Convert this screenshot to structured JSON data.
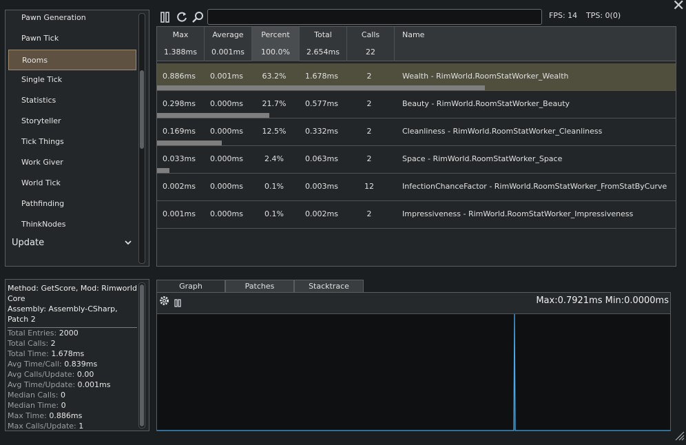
{
  "sidebar": {
    "items": [
      {
        "label": "Pawn Generation"
      },
      {
        "label": "Pawn Tick"
      },
      {
        "label": "Rooms",
        "selected": true
      },
      {
        "label": "Single Tick"
      },
      {
        "label": "Statistics"
      },
      {
        "label": "Storyteller"
      },
      {
        "label": "Tick Things"
      },
      {
        "label": "Work Giver"
      },
      {
        "label": "World Tick"
      },
      {
        "label": "Pathfinding"
      },
      {
        "label": "ThinkNodes"
      }
    ],
    "group": {
      "label": "Update"
    }
  },
  "toolbar": {
    "search_value": "",
    "fps_label": "FPS: 14",
    "tps_label": "TPS: 0(0)"
  },
  "table": {
    "columns": {
      "max": {
        "label": "Max",
        "summary": "1.388ms"
      },
      "average": {
        "label": "Average",
        "summary": "0.001ms"
      },
      "percent": {
        "label": "Percent",
        "summary": "100.0%"
      },
      "total": {
        "label": "Total",
        "summary": "2.654ms"
      },
      "calls": {
        "label": "Calls",
        "summary": "22"
      },
      "name": {
        "label": "Name"
      }
    },
    "rows": [
      {
        "max": "0.886ms",
        "average": "0.001ms",
        "percent": "63.2%",
        "total": "1.678ms",
        "calls": "2",
        "name": "Wealth - RimWorld.RoomStatWorker_Wealth",
        "fraction": 0.632
      },
      {
        "max": "0.298ms",
        "average": "0.000ms",
        "percent": "21.7%",
        "total": "0.577ms",
        "calls": "2",
        "name": "Beauty - RimWorld.RoomStatWorker_Beauty",
        "fraction": 0.217
      },
      {
        "max": "0.169ms",
        "average": "0.000ms",
        "percent": "12.5%",
        "total": "0.332ms",
        "calls": "2",
        "name": "Cleanliness - RimWorld.RoomStatWorker_Cleanliness",
        "fraction": 0.125
      },
      {
        "max": "0.033ms",
        "average": "0.000ms",
        "percent": "2.4%",
        "total": "0.063ms",
        "calls": "2",
        "name": "Space - RimWorld.RoomStatWorker_Space",
        "fraction": 0.024
      },
      {
        "max": "0.002ms",
        "average": "0.000ms",
        "percent": "0.1%",
        "total": "0.003ms",
        "calls": "12",
        "name": "InfectionChanceFactor - RimWorld.RoomStatWorker_FromStatByCurve",
        "fraction": 0.001
      },
      {
        "max": "0.001ms",
        "average": "0.000ms",
        "percent": "0.1%",
        "total": "0.002ms",
        "calls": "2",
        "name": "Impressiveness - RimWorld.RoomStatWorker_Impressiveness",
        "fraction": 0.001
      }
    ]
  },
  "details": {
    "header": "Method: GetScore, Mod: Rimworld Core\nAssembly: Assembly-CSharp, Patch 2",
    "stats": [
      {
        "label": "Total Entries:",
        "value": "2000"
      },
      {
        "label": "Total Calls:",
        "value": "2"
      },
      {
        "label": "Total Time:",
        "value": "1.678ms"
      },
      {
        "label": "Avg Time/Call:",
        "value": "0.839ms"
      },
      {
        "label": "Avg Calls/Update:",
        "value": "0.00"
      },
      {
        "label": "Avg Time/Update:",
        "value": "0.001ms"
      },
      {
        "label": "Median Calls:",
        "value": "0"
      },
      {
        "label": "Median Time:",
        "value": "0"
      },
      {
        "label": "Max Time:",
        "value": "0.886ms"
      },
      {
        "label": "Max Calls/Update:",
        "value": "1"
      }
    ]
  },
  "graph": {
    "tabs": [
      "Graph",
      "Patches",
      "Stacktrace"
    ],
    "active_tab": "Graph",
    "maxmin": "Max:0.7921ms Min:0.0000ms",
    "max_line_color": "#b0303a",
    "spike_color": "#4aa8e8"
  },
  "colors": {
    "selected_item": "#5e5141",
    "selected_row": "#504f3e",
    "bar": "#7e7e7e"
  }
}
